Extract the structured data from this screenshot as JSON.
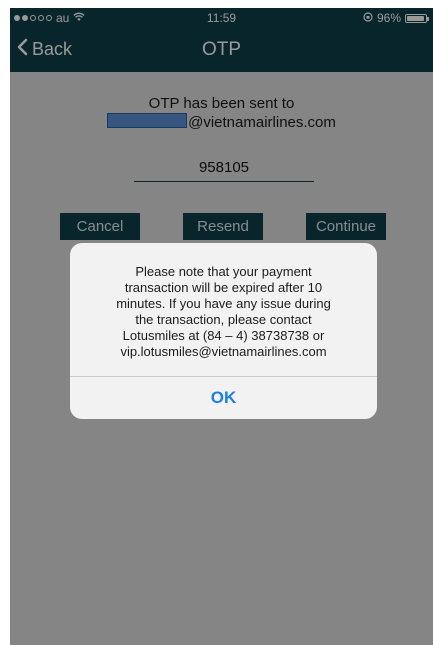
{
  "status_bar": {
    "carrier": "au",
    "time": "11:59",
    "battery_text": "96%",
    "battery_level": 0.96,
    "signal_dots": 5,
    "signal_filled": 2
  },
  "nav": {
    "back_label": "Back",
    "title": "OTP"
  },
  "main": {
    "sent_text": "OTP has been sent to",
    "email_domain": "@vietnamairlines.com",
    "otp_value": "958105",
    "buttons": {
      "cancel": "Cancel",
      "resend": "Resend",
      "continue": "Continue"
    }
  },
  "alert": {
    "lines": [
      "Please note that your payment",
      "transaction will be expired after 10",
      "minutes. If you have any issue during",
      "the transaction, please contact",
      "Lotusmiles at (84 – 4) 38738738 or",
      "vip.lotusmiles@vietnamairlines.com"
    ],
    "ok_label": "OK"
  },
  "colors": {
    "accent": "#0c3e49",
    "alert_button": "#1a7ef0",
    "redaction": "#5b8fd6"
  }
}
